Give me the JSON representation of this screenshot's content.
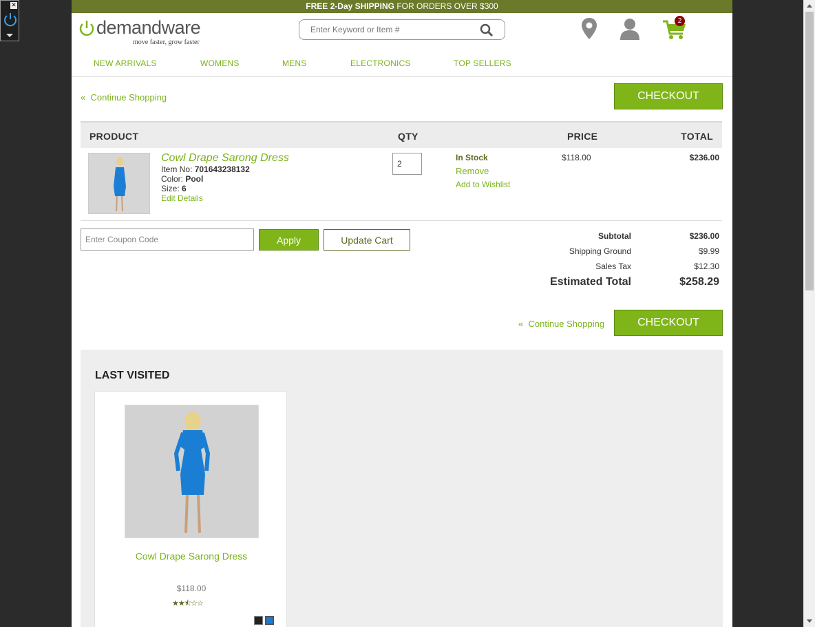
{
  "promo": {
    "part1": "FREE 2-Day ",
    "bold": "SHIPPING",
    "part2": " FOR ORDERS OVER $300"
  },
  "logo": {
    "word": "demandware",
    "tagline": "move faster, grow faster"
  },
  "search": {
    "placeholder": "Enter Keyword or Item #"
  },
  "cart": {
    "count": "2"
  },
  "nav": [
    "NEW ARRIVALS",
    "WOMENS",
    "MENS",
    "ELECTRONICS",
    "TOP SELLERS"
  ],
  "actions": {
    "continue": "Continue Shopping",
    "checkout": "CHECKOUT"
  },
  "table": {
    "headers": {
      "product": "PRODUCT",
      "qty": "QTY",
      "price": "PRICE",
      "total": "TOTAL"
    }
  },
  "item": {
    "name": "Cowl Drape Sarong Dress",
    "item_no_label": "Item No: ",
    "item_no": "701643238132",
    "color_label": "Color: ",
    "color": "Pool",
    "size_label": "Size: ",
    "size": "6",
    "edit": "Edit Details",
    "qty": "2",
    "stock": "In Stock",
    "remove": "Remove",
    "wishlist": "Add to Wishlist",
    "price": "$118.00",
    "total": "$236.00"
  },
  "coupon": {
    "placeholder": "Enter Coupon Code",
    "apply": "Apply",
    "update": "Update Cart"
  },
  "summary": {
    "subtotal_label": "Subtotal",
    "subtotal": "$236.00",
    "shipping_label": "Shipping Ground",
    "shipping": "$9.99",
    "tax_label": "Sales Tax",
    "tax": "$12.30",
    "estimated_label": "Estimated Total",
    "estimated": "$258.29"
  },
  "last_visited": {
    "title": "LAST VISITED",
    "product": {
      "name": "Cowl Drape Sarong Dress",
      "price": "$118.00",
      "rating": 2.5,
      "max_rating": 5
    }
  },
  "colors": {
    "accent": "#7fb519",
    "promo_bar": "#6b7a2a",
    "dress": "#1a7fd4",
    "badge": "#8b0000"
  }
}
